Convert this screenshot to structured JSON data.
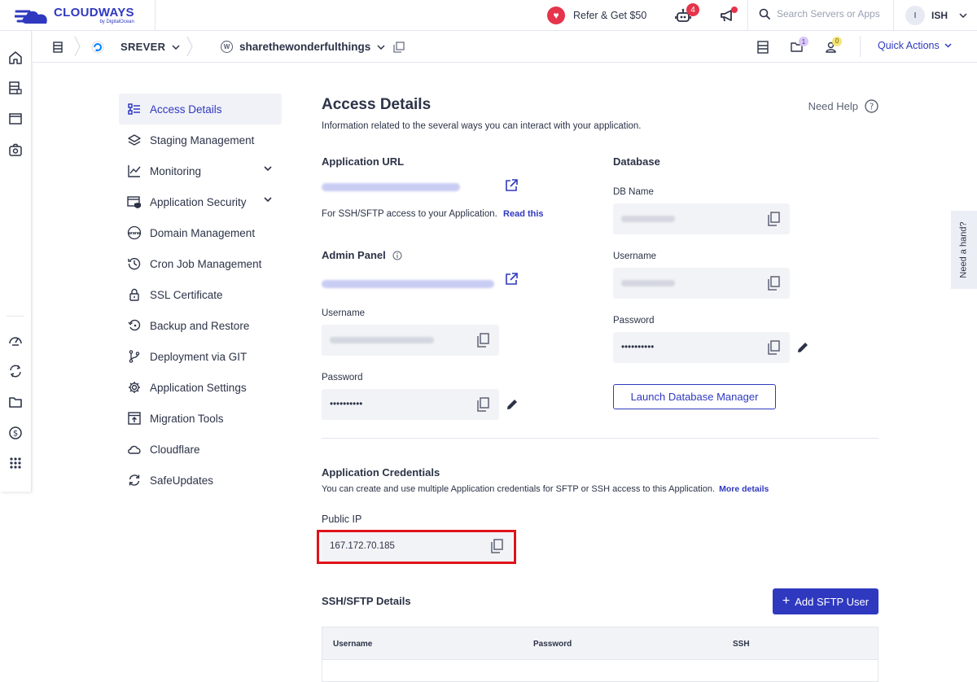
{
  "header": {
    "brand": "CLOUDWAYS",
    "brand_sub": "by DigitalOcean",
    "refer_label": "Refer & Get $50",
    "bot_badge": "4",
    "search_placeholder": "Search Servers or Apps",
    "user_initial": "I",
    "user_name": "ISH"
  },
  "subbar": {
    "server_label": "SREVER",
    "app_name": "sharethewonderfulthings",
    "folder_badge": "1",
    "person_badge": "0",
    "quick_actions": "Quick Actions"
  },
  "menu": {
    "items": [
      {
        "label": "Access Details",
        "icon": "access-details-icon"
      },
      {
        "label": "Staging Management",
        "icon": "layers-icon"
      },
      {
        "label": "Monitoring",
        "icon": "chart-icon"
      },
      {
        "label": "Application Security",
        "icon": "shield-icon"
      },
      {
        "label": "Domain Management",
        "icon": "www-icon"
      },
      {
        "label": "Cron Job Management",
        "icon": "history-icon"
      },
      {
        "label": "SSL Certificate",
        "icon": "lock-icon"
      },
      {
        "label": "Backup and Restore",
        "icon": "restore-icon"
      },
      {
        "label": "Deployment via GIT",
        "icon": "git-icon"
      },
      {
        "label": "Application Settings",
        "icon": "gear-icon"
      },
      {
        "label": "Migration Tools",
        "icon": "migration-icon"
      },
      {
        "label": "Cloudflare",
        "icon": "cloud-icon"
      },
      {
        "label": "SafeUpdates",
        "icon": "refresh-icon"
      }
    ]
  },
  "main": {
    "title": "Access Details",
    "subtitle": "Information related to the several ways you can interact with your application.",
    "need_help": "Need Help",
    "app_url": {
      "title": "Application URL",
      "ssh_note": "For SSH/SFTP access to your Application.",
      "read_this": "Read this"
    },
    "admin_panel": {
      "title": "Admin Panel",
      "username_label": "Username",
      "password_label": "Password",
      "password_value": "••••••••••"
    },
    "database": {
      "title": "Database",
      "db_name_label": "DB Name",
      "username_label": "Username",
      "password_label": "Password",
      "password_value": "••••••••••",
      "launch_button": "Launch Database Manager"
    },
    "credentials": {
      "title": "Application Credentials",
      "description": "You can create and use multiple Application credentials for SFTP or SSH access to this Application.",
      "more_details": "More details",
      "public_ip_label": "Public IP",
      "public_ip_value": "167.172.70.185"
    },
    "ssh": {
      "title": "SSH/SFTP Details",
      "add_button": "Add SFTP User",
      "columns": [
        "Username",
        "Password",
        "SSH"
      ]
    }
  },
  "need_hand": "Need a hand?",
  "colors": {
    "brand_blue": "#2f39bf",
    "alert_red": "#e5344b",
    "highlight_red": "#e1121b"
  }
}
